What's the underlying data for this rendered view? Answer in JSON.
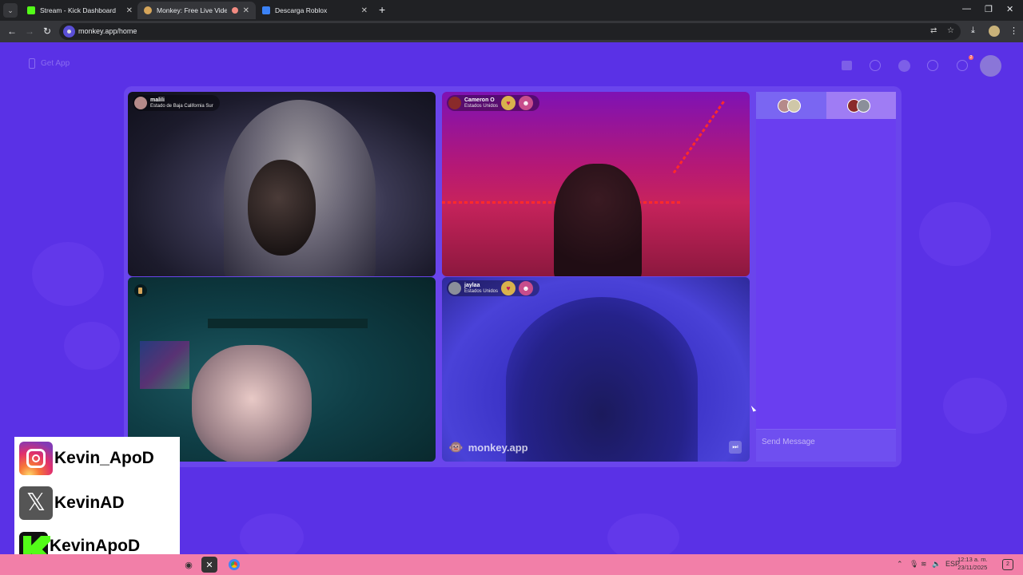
{
  "browser": {
    "tabs": [
      {
        "title": "Stream - Kick Dashboard",
        "active": false,
        "favicon_color": "#53fc18"
      },
      {
        "title": "Monkey: Free Live Video Ch",
        "active": true,
        "favicon_color": "#d6a55a"
      },
      {
        "title": "Descarga Roblox",
        "active": false,
        "favicon_color": "#3b82f6"
      }
    ],
    "url": "monkey.app/home"
  },
  "header": {
    "get_app_label": "Get App",
    "notification_count": "2"
  },
  "videos": [
    {
      "username": "malili",
      "location": "Estado de Baja California Sur",
      "has_badges": false
    },
    {
      "username": "Cameron O",
      "location": "Estados Unidos",
      "has_badges": true
    },
    {
      "username": "",
      "location": "",
      "has_badges": false
    },
    {
      "username": "jaylaa",
      "location": "Estados Unidos",
      "has_badges": true
    }
  ],
  "watermark": "monkey.app",
  "chat": {
    "input_placeholder": "Send Message"
  },
  "overlay": {
    "instagram": "Kevin_ApoD",
    "x": "KevinAD",
    "kick": "KevinApoD"
  },
  "taskbar": {
    "language": "ESP",
    "time": "12:13 a. m.",
    "date": "23/11/2025",
    "notification_count": "2"
  },
  "colors": {
    "page_bg": "#5a31e6",
    "card_bg": "#6a45ec",
    "taskbar_bg": "#f27fa8",
    "kick_green": "#53fc18"
  }
}
